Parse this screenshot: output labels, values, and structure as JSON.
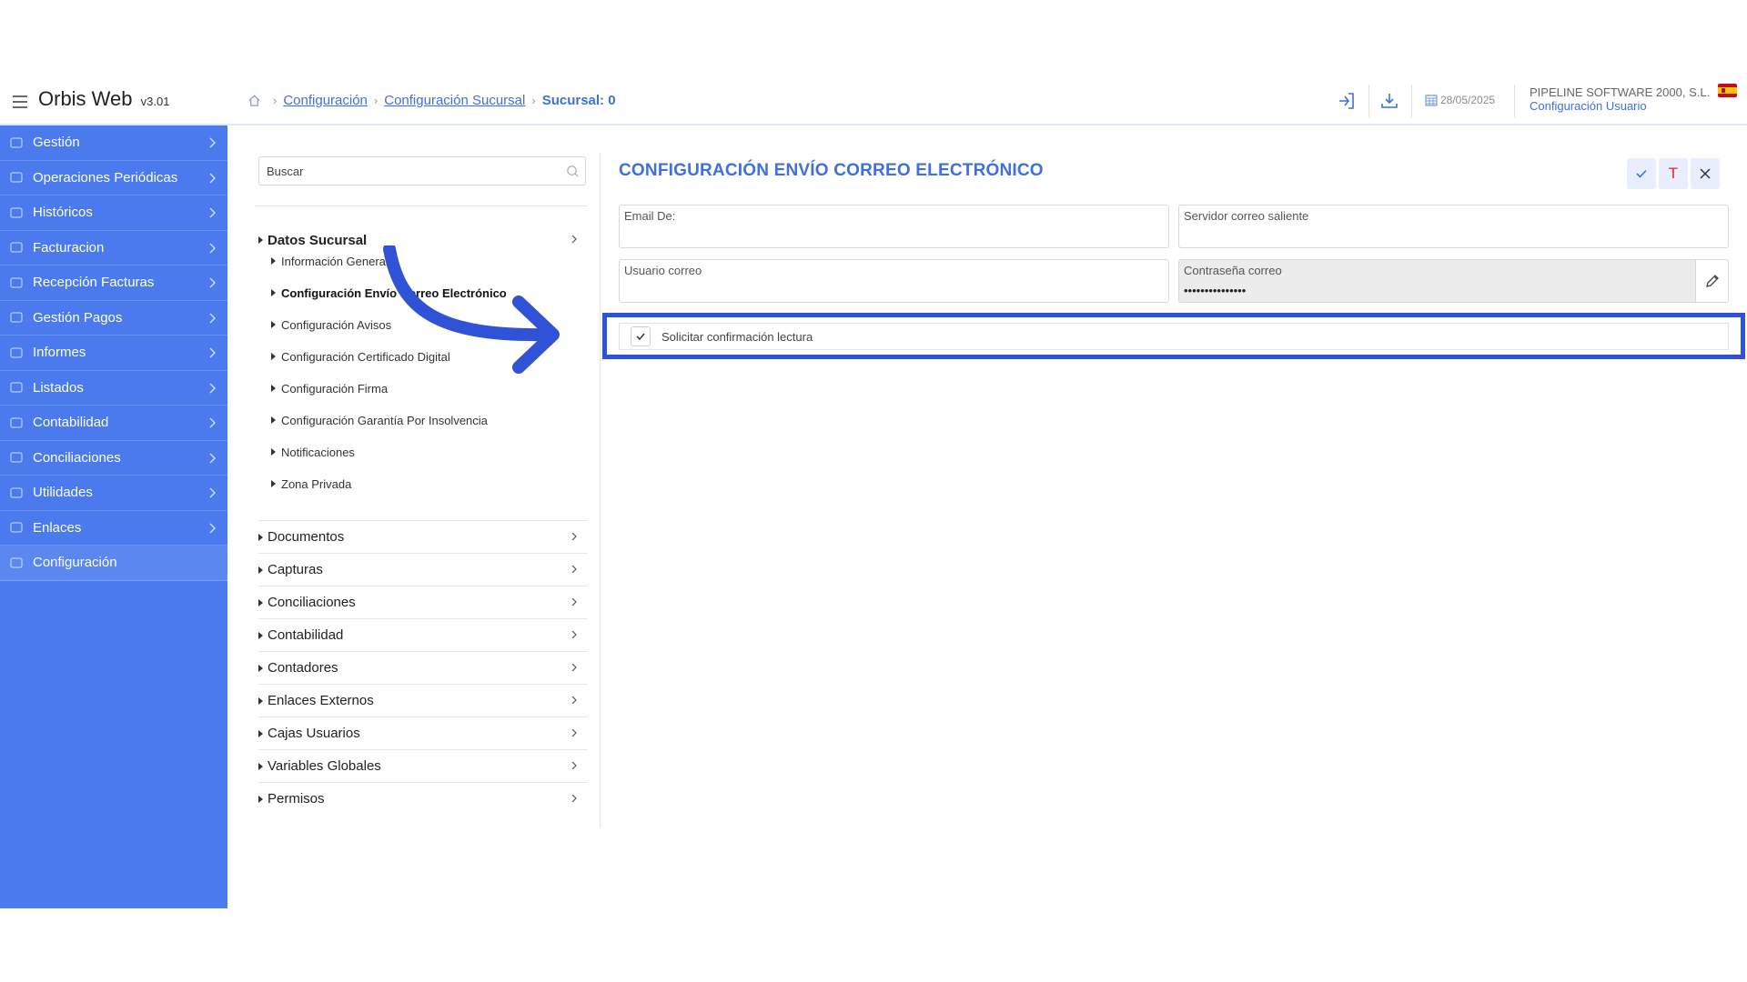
{
  "app": {
    "title": "Orbis Web",
    "version": "v3.01"
  },
  "breadcrumb": {
    "items": [
      "Configuración",
      "Configuración Sucursal"
    ],
    "current": "Sucursal: 0"
  },
  "header": {
    "date": "28/05/2025",
    "company": "PIPELINE SOFTWARE 2000, S.L...",
    "user_config": "Configuración Usuario"
  },
  "sidebar": {
    "items": [
      {
        "label": "Gestión",
        "icon": "briefcase-icon"
      },
      {
        "label": "Operaciones Periódicas",
        "icon": "share-nodes-icon"
      },
      {
        "label": "Históricos",
        "icon": "folder-icon"
      },
      {
        "label": "Facturacion",
        "icon": "flask-icon"
      },
      {
        "label": "Recepción Facturas",
        "icon": "invoice-icon"
      },
      {
        "label": "Gestión Pagos",
        "icon": "building-icon"
      },
      {
        "label": "Informes",
        "icon": "report-icon"
      },
      {
        "label": "Listados",
        "icon": "list-document-icon"
      },
      {
        "label": "Contabilidad",
        "icon": "ledger-icon"
      },
      {
        "label": "Conciliaciones",
        "icon": "link-icon"
      },
      {
        "label": "Utilidades",
        "icon": "tools-icon"
      },
      {
        "label": "Enlaces",
        "icon": "chain-icon"
      },
      {
        "label": "Configuración",
        "icon": "gear-icon"
      }
    ],
    "active_index": 12
  },
  "tree": {
    "search_placeholder": "Buscar",
    "open_group": "Datos Sucursal",
    "sub_items": [
      "Información General",
      "Configuración Envío Correo Electrónico",
      "Configuración Avisos",
      "Configuración Certificado Digital",
      "Configuración Firma",
      "Configuración Garantía Por Insolvencia",
      "Notificaciones",
      "Zona Privada"
    ],
    "selected_sub_index": 1,
    "groups": [
      "Documentos",
      "Capturas",
      "Conciliaciones",
      "Contabilidad",
      "Contadores",
      "Enlaces Externos",
      "Cajas Usuarios",
      "Variables Globales",
      "Permisos"
    ]
  },
  "form": {
    "title": "CONFIGURACIÓN ENVÍO CORREO ELECTRÓNICO",
    "fields": {
      "email_de": {
        "label": "Email De:",
        "value": ""
      },
      "servidor": {
        "label": "Servidor correo saliente",
        "value": ""
      },
      "usuario": {
        "label": "Usuario correo",
        "value": ""
      },
      "password": {
        "label": "Contraseña correo",
        "value": "•••••••••••••••"
      }
    },
    "checkbox": {
      "label": "Solicitar confirmación lectura",
      "checked": true
    },
    "toolbar": {
      "accept_icon": "check-icon",
      "t_label": "T",
      "close_icon": "close-icon"
    }
  },
  "colors": {
    "sidebar": "#4a7aee",
    "accent": "#3f6fe0",
    "highlight": "#2f52d6",
    "t_button": "#e02424"
  }
}
